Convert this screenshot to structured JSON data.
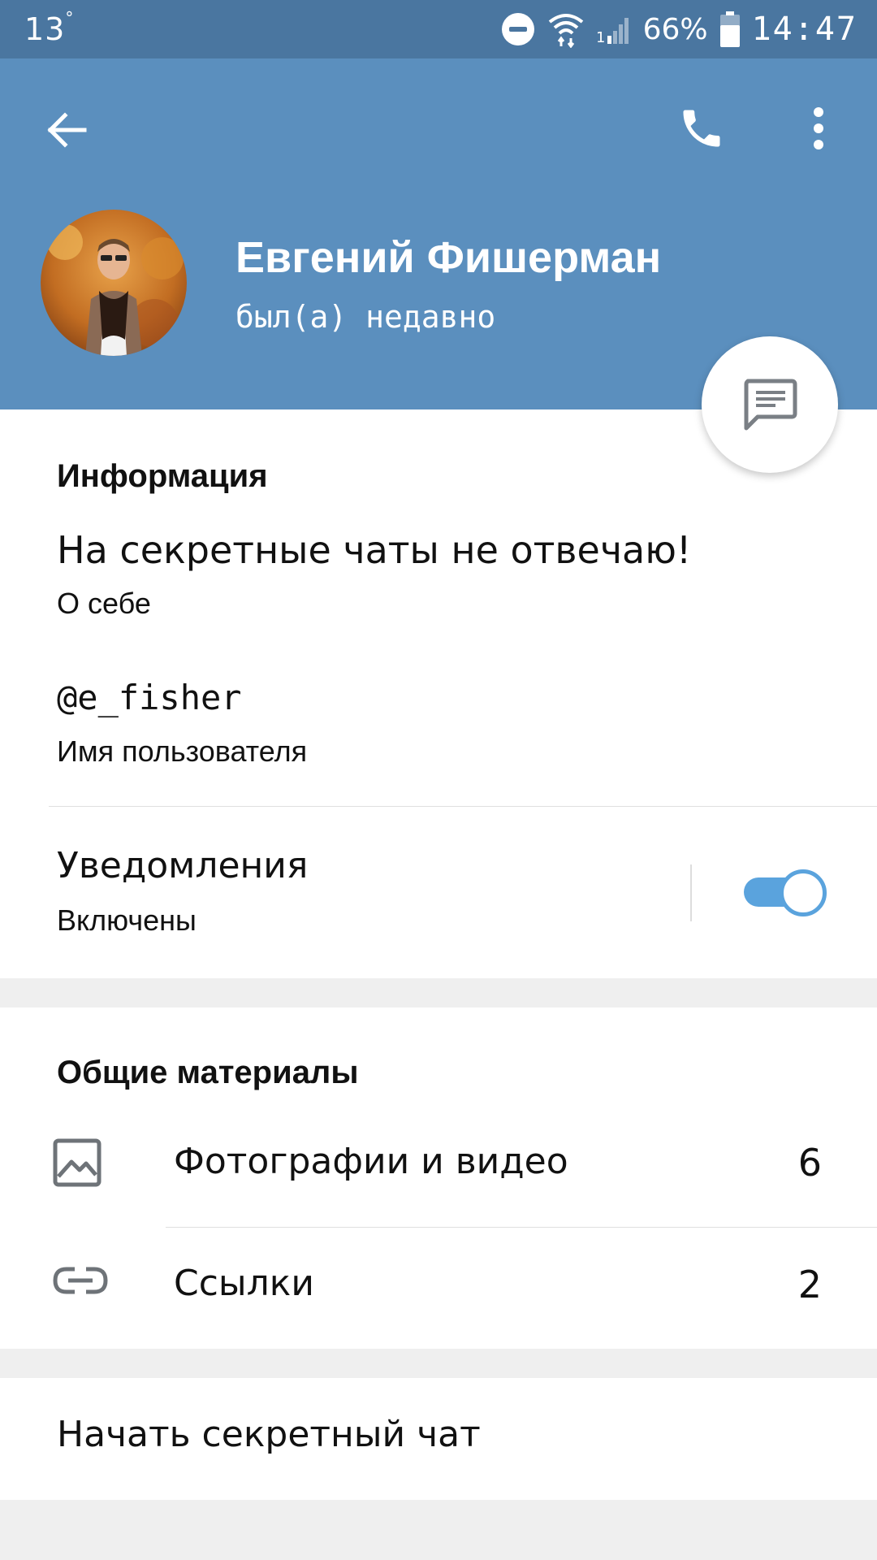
{
  "status_bar": {
    "temperature": "13",
    "degree": "°",
    "battery": "66%",
    "time": "14:47",
    "icons": [
      "do-not-disturb-icon",
      "wifi-icon",
      "signal-icon",
      "battery-icon"
    ]
  },
  "header": {
    "name": "Евгений Фишерман",
    "status": "был(а) недавно",
    "icons": [
      "back-arrow-icon",
      "phone-icon",
      "more-vert-icon",
      "message-icon"
    ],
    "background_color": "#5b8fbe"
  },
  "info": {
    "section_title": "Информация",
    "bio_value": "На секретные чаты не отвечаю!",
    "bio_caption": "О себе",
    "username_value": "@e_fisher",
    "username_caption": "Имя пользователя",
    "notifications_label": "Уведомления",
    "notifications_state": "Включены",
    "notifications_on": true
  },
  "shared": {
    "section_title": "Общие материалы",
    "items": [
      {
        "label": "Фотографии и видео",
        "count": "6",
        "icon": "image-icon"
      },
      {
        "label": "Ссылки",
        "count": "2",
        "icon": "link-icon"
      }
    ]
  },
  "actions": {
    "secret_chat": "Начать секретный чат"
  },
  "colors": {
    "accent": "#5aa3dd",
    "status_bar": "#4a76a0"
  }
}
